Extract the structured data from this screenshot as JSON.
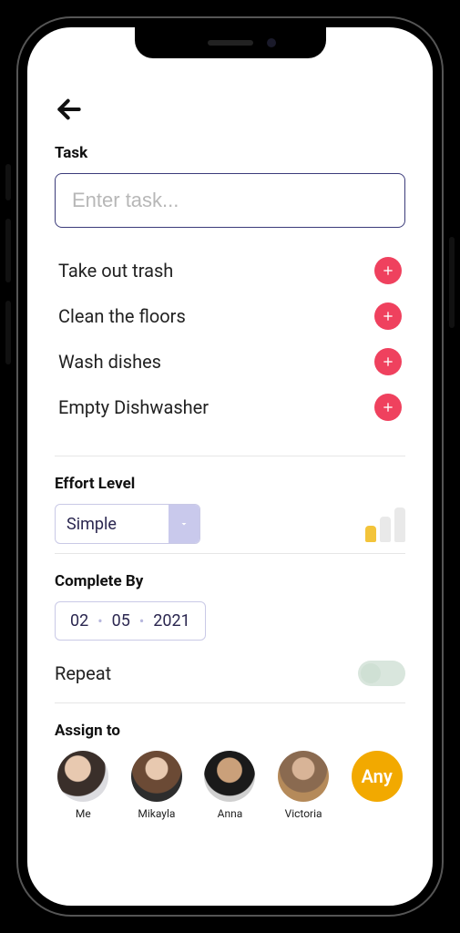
{
  "task": {
    "label": "Task",
    "placeholder": "Enter task...",
    "suggestions": [
      "Take out trash",
      "Clean the floors",
      "Wash dishes",
      "Empty Dishwasher"
    ]
  },
  "effort": {
    "label": "Effort Level",
    "selected": "Simple",
    "level_index": 1
  },
  "complete_by": {
    "label": "Complete By",
    "day": "02",
    "month": "05",
    "year": "2021"
  },
  "repeat": {
    "label": "Repeat",
    "on": false
  },
  "assign": {
    "label": "Assign to",
    "people": [
      {
        "name": "Me"
      },
      {
        "name": "Mikayla"
      },
      {
        "name": "Anna"
      },
      {
        "name": "Victoria"
      }
    ],
    "any_label": "Any"
  },
  "icons": {
    "back": "back-arrow",
    "add": "plus-circle",
    "caret": "caret-down"
  }
}
